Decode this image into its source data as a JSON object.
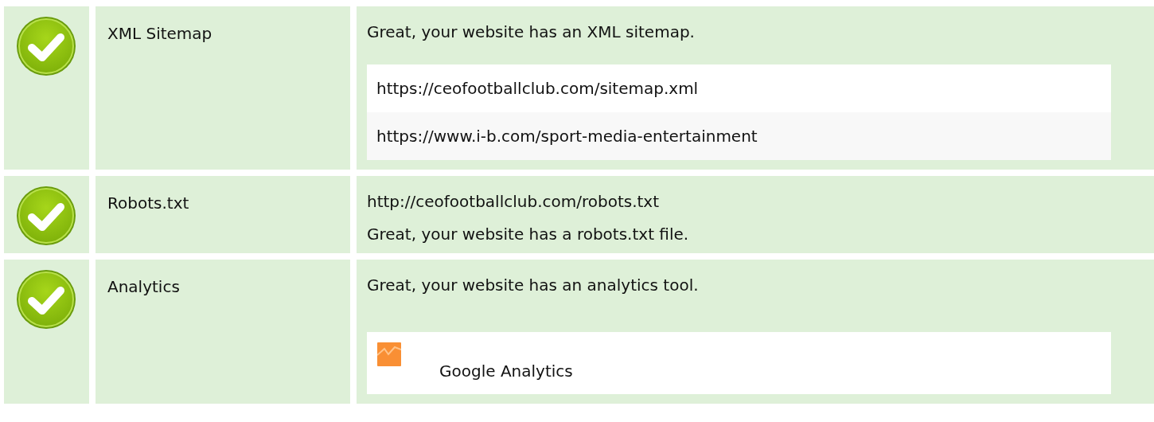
{
  "checks": [
    {
      "kind": "pass",
      "name": "XML Sitemap",
      "items": [
        {
          "kind": "text",
          "text": "Great, your website has an XML sitemap."
        },
        {
          "kind": "links",
          "links": [
            "https://ceofootballclub.com/sitemap.xml",
            "https://www.i-b.com/sport-media-entertainment"
          ]
        }
      ]
    },
    {
      "kind": "pass",
      "name": "Robots.txt",
      "items": [
        {
          "kind": "text",
          "text": "http://ceofootballclub.com/robots.txt"
        },
        {
          "kind": "text",
          "text": "Great, your website has a robots.txt file."
        }
      ]
    },
    {
      "kind": "pass",
      "name": "Analytics",
      "items": [
        {
          "kind": "text",
          "text": "Great, your website has an analytics tool."
        },
        {
          "kind": "tools",
          "tools": [
            "Google Analytics"
          ]
        }
      ]
    }
  ]
}
